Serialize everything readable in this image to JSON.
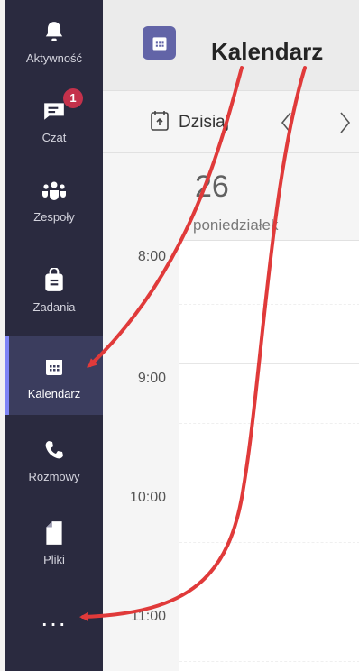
{
  "rail": {
    "items": [
      {
        "label": "Aktywność",
        "icon": "bell-icon"
      },
      {
        "label": "Czat",
        "icon": "chat-icon",
        "badge": "1"
      },
      {
        "label": "Zespoły",
        "icon": "teams-icon"
      },
      {
        "label": "Zadania",
        "icon": "tasks-icon"
      },
      {
        "label": "Kalendarz",
        "icon": "calendar-icon",
        "active": true
      },
      {
        "label": "Rozmowy",
        "icon": "phone-icon"
      },
      {
        "label": "Pliki",
        "icon": "file-icon"
      }
    ],
    "more": "..."
  },
  "header": {
    "title": "Kalendarz",
    "icon": "calendar-icon"
  },
  "toolbar": {
    "today_label": "Dzisiaj",
    "prev_icon": "chevron-left-icon",
    "next_icon": "chevron-right-icon"
  },
  "day": {
    "number": "26",
    "name": "poniedziałek"
  },
  "times": [
    "8:00",
    "9:00",
    "10:00",
    "11:00"
  ],
  "colors": {
    "rail_bg": "#2a2a3f",
    "accent": "#6264a7",
    "badge": "#c4314b",
    "annotation_arrow": "#e03a3a"
  }
}
